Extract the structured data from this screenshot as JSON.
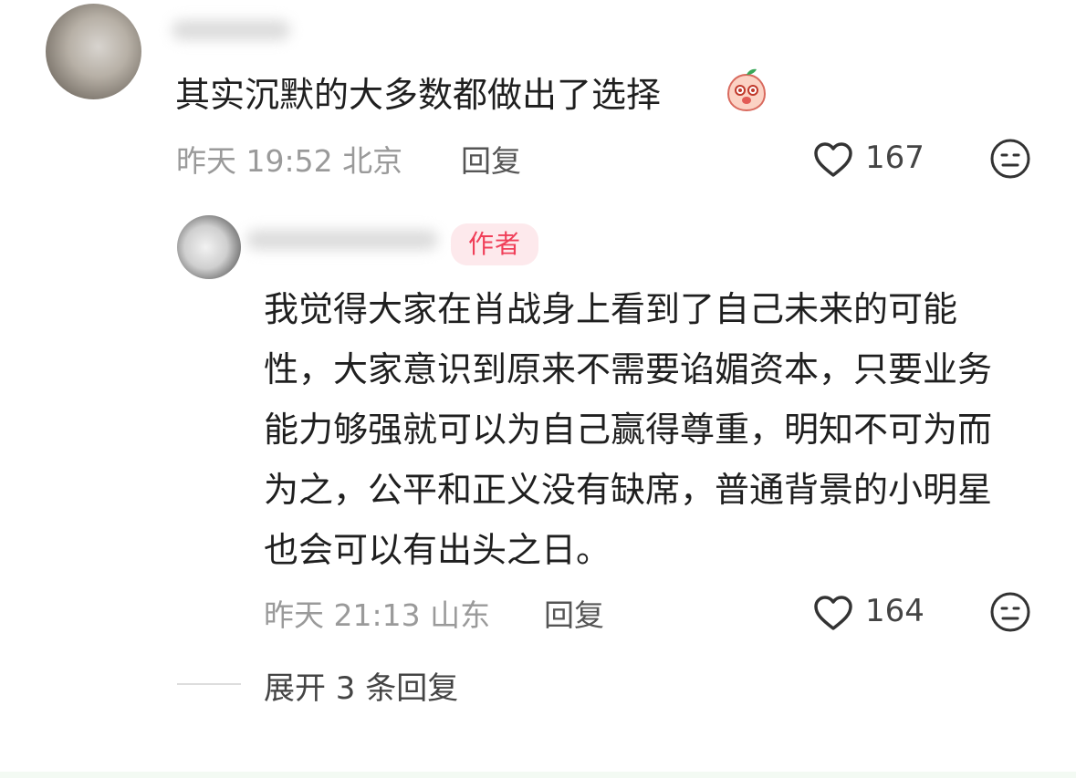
{
  "comments": [
    {
      "text": "其实沉默的大多数都做出了选择",
      "emoji": "peach-face-icon",
      "meta": "昨天 19:52 北京",
      "reply_label": "回复",
      "likes": "167"
    },
    {
      "badge": "作者",
      "text": "我觉得大家在肖战身上看到了自己未来的可能性，大家意识到原来不需要谄媚资本，只要业务能力够强就可以为自己赢得尊重，明知不可为而为之，公平和正义没有缺席，普通背景的小明星也会可以有出头之日。",
      "meta": "昨天 21:13 山东",
      "reply_label": "回复",
      "likes": "164"
    }
  ],
  "expand_replies_label": "展开 3 条回复",
  "colors": {
    "badge_text": "#f03e58",
    "badge_bg": "#fde9ec",
    "meta_text": "#9a9a9a"
  }
}
